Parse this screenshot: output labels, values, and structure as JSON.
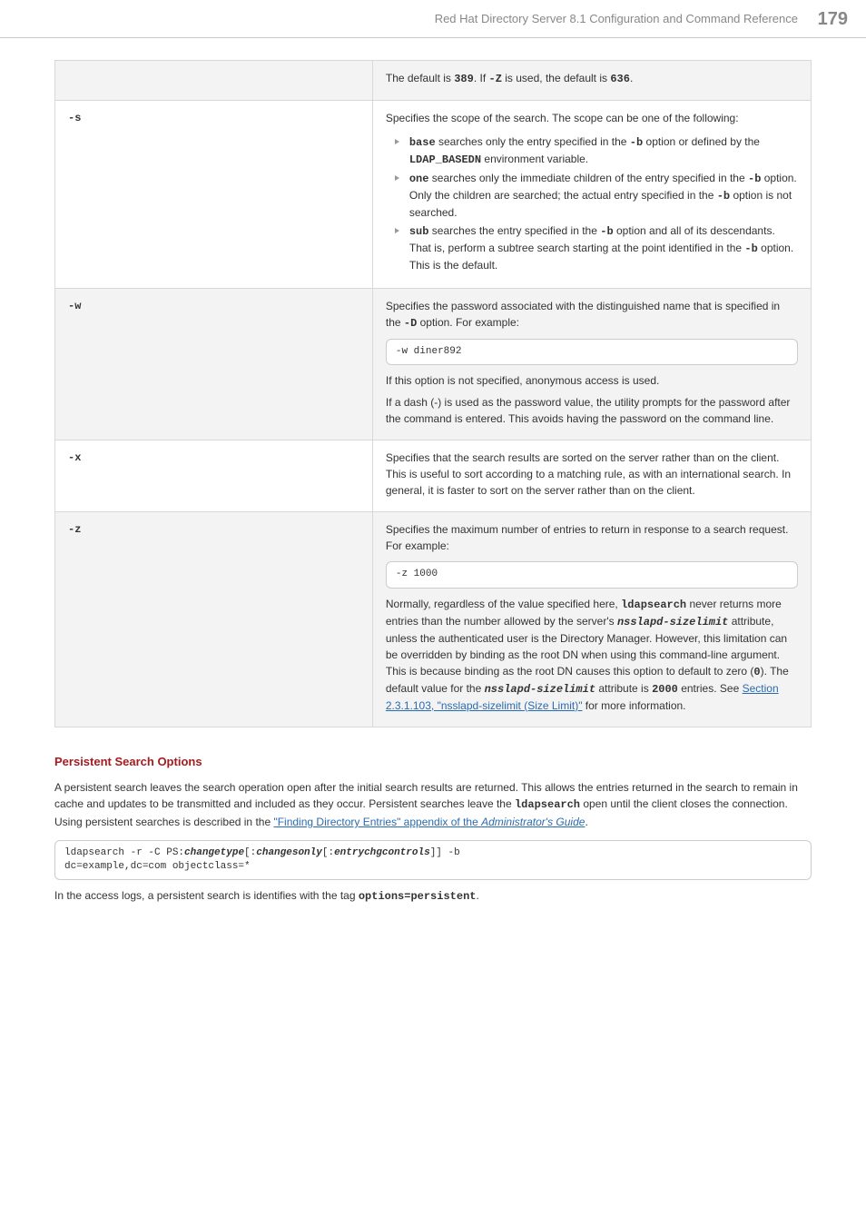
{
  "header": {
    "title": "Red Hat Directory Server 8.1 Configuration and Command Reference",
    "page": "179"
  },
  "rows": [
    {
      "shade": true,
      "opt": "",
      "paras": [
        [
          {
            "t": "The default is "
          },
          {
            "t": "389",
            "cls": "mono b"
          },
          {
            "t": ". If "
          },
          {
            "t": "-Z",
            "cls": "mono b"
          },
          {
            "t": " is used, the default is "
          },
          {
            "t": "636",
            "cls": "mono b"
          },
          {
            "t": "."
          }
        ]
      ]
    },
    {
      "shade": false,
      "opt": "-s",
      "paras": [
        [
          {
            "t": "Specifies the scope of the search. The scope can be one of the following:"
          }
        ]
      ],
      "bullets": [
        [
          {
            "t": "base",
            "cls": "mono b"
          },
          {
            "t": " searches only the entry specified in the "
          },
          {
            "t": "-b",
            "cls": "mono b"
          },
          {
            "t": " option or defined by the "
          },
          {
            "t": "LDAP_BASEDN",
            "cls": "mono b"
          },
          {
            "t": " environment variable."
          }
        ],
        [
          {
            "t": "one",
            "cls": "mono b"
          },
          {
            "t": " searches only the immediate children of the entry specified in the "
          },
          {
            "t": "-b",
            "cls": "mono b"
          },
          {
            "t": " option. Only the children are searched; the actual entry specified in the "
          },
          {
            "t": "-b",
            "cls": "mono b"
          },
          {
            "t": " option is not searched."
          }
        ],
        [
          {
            "t": "sub",
            "cls": "mono b"
          },
          {
            "t": " searches the entry specified in the "
          },
          {
            "t": "-b",
            "cls": "mono b"
          },
          {
            "t": " option and all of its descendants. That is, perform a subtree search starting at the point identified in the "
          },
          {
            "t": "-b",
            "cls": "mono b"
          },
          {
            "t": " option. This is the default."
          }
        ]
      ]
    },
    {
      "shade": true,
      "opt": "-w",
      "paras": [
        [
          {
            "t": "Specifies the password associated with the distinguished name that is specified in the "
          },
          {
            "t": "-D",
            "cls": "mono b"
          },
          {
            "t": " option. For example:"
          }
        ]
      ],
      "code": "-w diner892",
      "paras2": [
        [
          {
            "t": "If this option is not specified, anonymous access is used."
          }
        ],
        [
          {
            "t": "If a dash (-) is used as the password value, the utility prompts for the password after the command is entered. This avoids having the password on the command line."
          }
        ]
      ]
    },
    {
      "shade": false,
      "opt": "-x",
      "paras": [
        [
          {
            "t": "Specifies that the search results are sorted on the server rather than on the client. This is useful to sort according to a matching rule, as with an international search. In general, it is faster to sort on the server rather than on the client."
          }
        ]
      ]
    },
    {
      "shade": true,
      "opt": "-z",
      "paras": [
        [
          {
            "t": "Specifies the maximum number of entries to return in response to a search request. For example:"
          }
        ]
      ],
      "code": "-z 1000",
      "paras2": [
        [
          {
            "t": "Normally, regardless of the value specified here, "
          },
          {
            "t": "ldapsearch",
            "cls": "mono b"
          },
          {
            "t": " never returns more entries than the number allowed by the server's "
          },
          {
            "t": "nsslapd-sizelimit",
            "cls": "mono bi"
          },
          {
            "t": " attribute, unless the authenticated user is the Directory Manager. However, this limitation can be overridden by binding as the root DN when using this command-line argument. This is because binding as the root DN causes this option to default to zero ("
          },
          {
            "t": "0",
            "cls": "mono b"
          },
          {
            "t": "). The default value for the "
          },
          {
            "t": "nsslapd-sizelimit",
            "cls": "mono bi"
          },
          {
            "t": " attribute is "
          },
          {
            "t": "2000",
            "cls": "mono b"
          },
          {
            "t": " entries. See "
          },
          {
            "t": "Section 2.3.1.103, \"nsslapd-sizelimit (Size Limit)\"",
            "link": true
          },
          {
            "t": " for more information."
          }
        ]
      ]
    }
  ],
  "section": {
    "heading": "Persistent Search Options",
    "p1_runs": [
      {
        "t": "A persistent search leaves the search operation open after the initial search results are returned. This allows the entries returned in the search to remain in cache and updates to be transmitted and included as they occur. Persistent searches leave the "
      },
      {
        "t": "ldapsearch",
        "cls": "mono b"
      },
      {
        "t": " open until the client closes the connection. Using persistent searches is described in the "
      },
      {
        "t": "\"Finding Directory Entries\" appendix of the ",
        "link": true
      },
      {
        "t": "Administrator's Guide",
        "link": true,
        "cls": "i"
      },
      {
        "t": "."
      }
    ],
    "code_runs": [
      {
        "t": "ldapsearch -r -C PS:"
      },
      {
        "t": "changetype",
        "cls": "bi"
      },
      {
        "t": "[:"
      },
      {
        "t": "changesonly",
        "cls": "bi"
      },
      {
        "t": "[:"
      },
      {
        "t": "entrychgcontrols",
        "cls": "bi"
      },
      {
        "t": "]] -b\ndc=example,dc=com objectclass=*"
      }
    ],
    "p2_runs": [
      {
        "t": "In the access logs, a persistent search is identifies with the tag "
      },
      {
        "t": "options=persistent",
        "cls": "mono b"
      },
      {
        "t": "."
      }
    ]
  }
}
